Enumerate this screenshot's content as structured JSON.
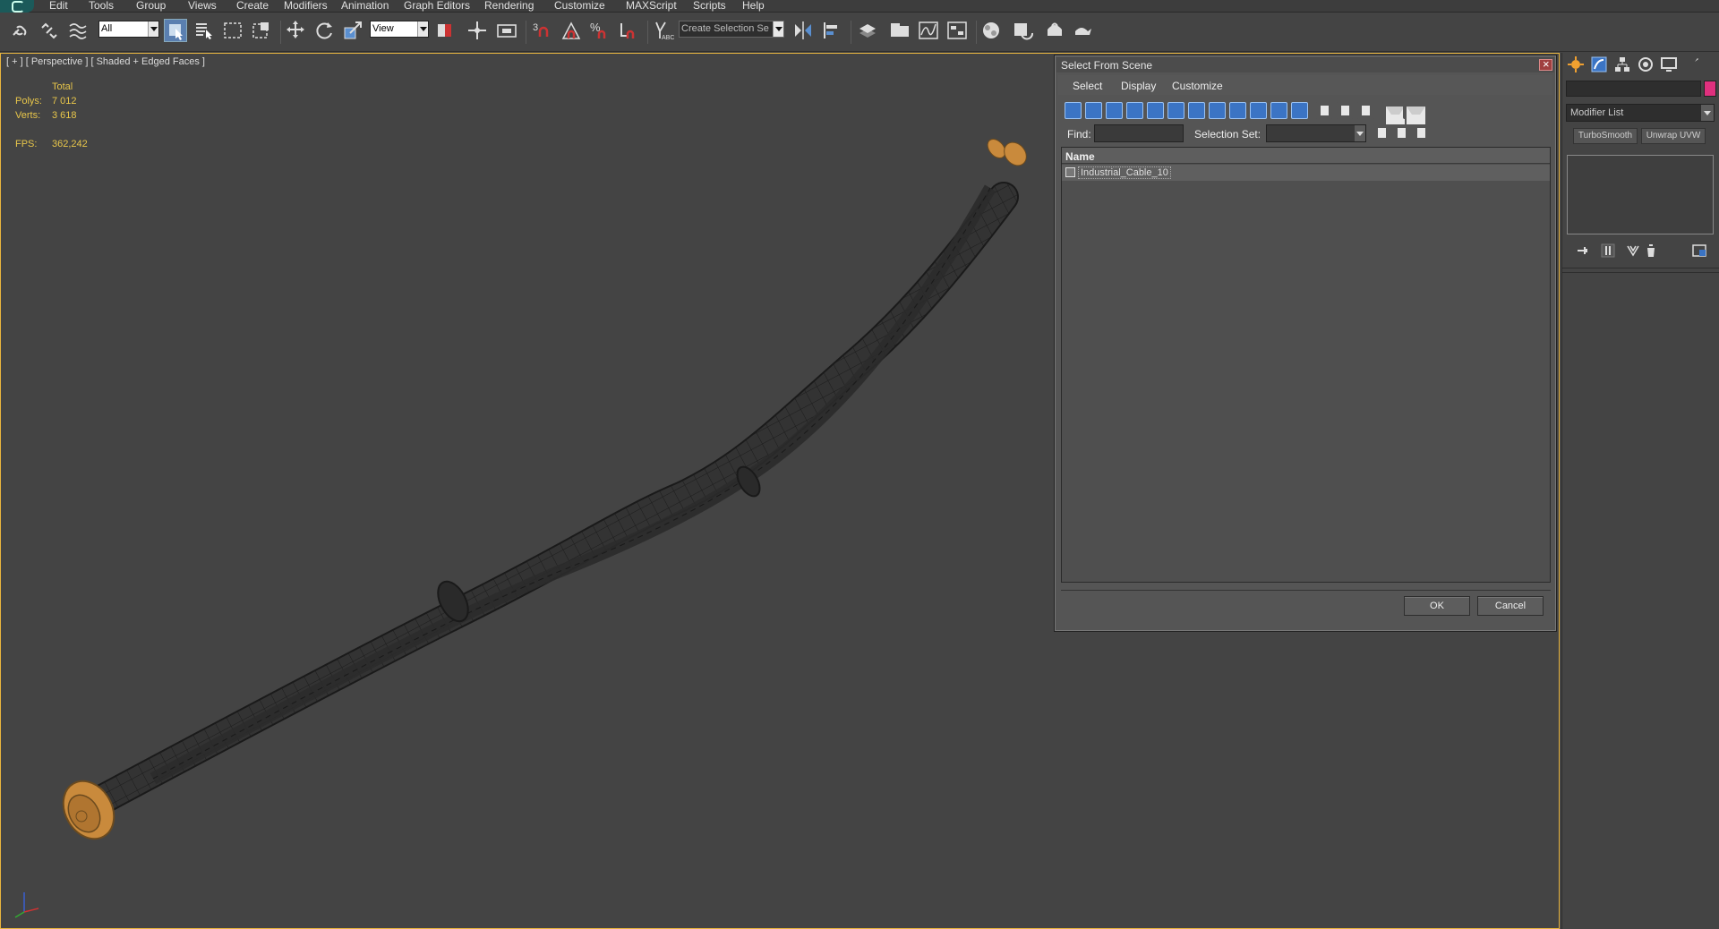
{
  "menubar": {
    "items": [
      "Edit",
      "Tools",
      "Group",
      "Views",
      "Create",
      "Modifiers",
      "Animation",
      "Graph Editors",
      "Rendering",
      "Customize",
      "MAXScript",
      "Scripts",
      "Help"
    ]
  },
  "toolbar": {
    "selection_filter": "All",
    "reference_coord": "View",
    "named_selection": "Create Selection Se"
  },
  "viewport": {
    "label": "[ + ] [ Perspective ] [ Shaded + Edged Faces ]",
    "stats": {
      "total_label": "Total",
      "polys_label": "Polys:",
      "polys_value": "7 012",
      "verts_label": "Verts:",
      "verts_value": "3 618",
      "fps_label": "FPS:",
      "fps_value": "362,242"
    }
  },
  "dialog": {
    "title": "Select From Scene",
    "menus": [
      "Select",
      "Display",
      "Customize"
    ],
    "find_label": "Find:",
    "find_value": "",
    "selection_set_label": "Selection Set:",
    "list_header": "Name",
    "items": [
      "Industrial_Cable_10"
    ],
    "ok_label": "OK",
    "cancel_label": "Cancel"
  },
  "command_panel": {
    "modifier_list": "Modifier List",
    "modifier_buttons": [
      "TurboSmooth",
      "Unwrap UVW"
    ],
    "object_color": "#e0307e"
  },
  "colors": {
    "viewport_border": "#e9b53e",
    "stats_text": "#e8c64a",
    "cable_end": "#c98a3c"
  }
}
